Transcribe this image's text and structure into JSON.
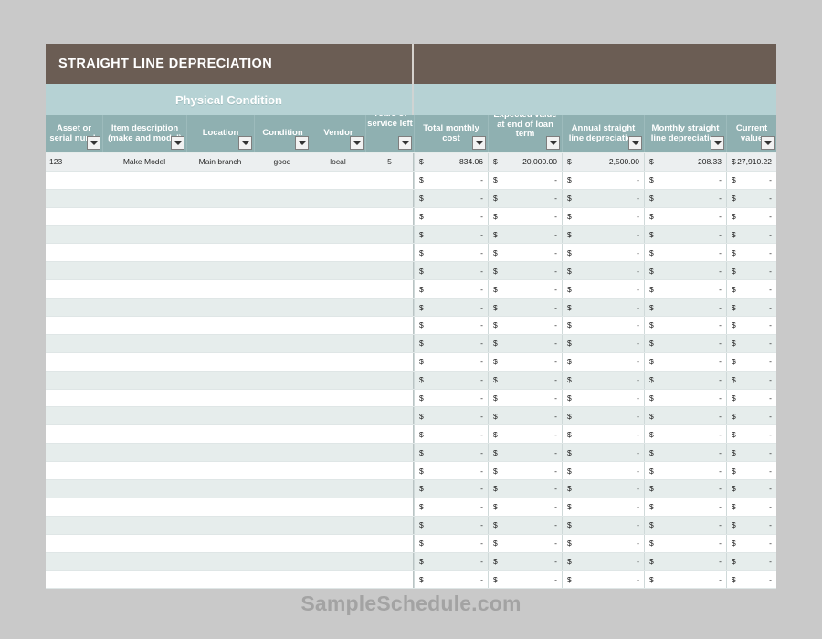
{
  "title": "STRAIGHT LINE DEPRECIATION",
  "group_band": {
    "label": "Physical Condition"
  },
  "colors": {
    "title_bar": "#6b5d54",
    "group_band": "#b6d2d4",
    "header_row": "#8fb0b1",
    "row_stripe": "#e6edec",
    "page_background": "#c9c9c9",
    "watermark": "#a3a3a3"
  },
  "columns": [
    {
      "key": "asset",
      "label": "Asset or serial number",
      "filter": true
    },
    {
      "key": "item",
      "label": "Item description (make and model)",
      "filter": true
    },
    {
      "key": "loc",
      "label": "Location",
      "filter": true
    },
    {
      "key": "cond",
      "label": "Condition",
      "filter": true
    },
    {
      "key": "vendor",
      "label": "Vendor",
      "filter": true
    },
    {
      "key": "years",
      "label": "Years of service left",
      "filter": true
    },
    {
      "key": "total",
      "label": "Total monthly cost",
      "filter": true
    },
    {
      "key": "exp",
      "label": "Expected value at end of loan term",
      "filter": true
    },
    {
      "key": "annual",
      "label": "Annual straight line depreciation",
      "filter": true
    },
    {
      "key": "month",
      "label": "Monthly straight line depreciation",
      "filter": true
    },
    {
      "key": "curr",
      "label": "Current value",
      "filter": true
    }
  ],
  "header_labels": {
    "asset": "Asset or serial numb",
    "item": "Item description (make and model)",
    "loc": "Location",
    "cond": "Condition",
    "vendor": "Vendor",
    "years": "Years of service left",
    "total": "Total monthly cost",
    "exp": "Expected value at end of loan term",
    "annual": "Annual straight line depreciation",
    "month": "Monthly straight line depreciation",
    "curr": "Current value"
  },
  "currency_symbol": "$",
  "empty_value": "-",
  "rows": [
    {
      "asset": "123",
      "item": "Make Model",
      "loc": "Main branch",
      "cond": "good",
      "vendor": "local",
      "years": "5",
      "total": "834.06",
      "exp": "20,000.00",
      "annual": "2,500.00",
      "month": "208.33",
      "curr": "27,910.22"
    },
    {
      "asset": "",
      "item": "",
      "loc": "",
      "cond": "",
      "vendor": "",
      "years": "",
      "total": "-",
      "exp": "-",
      "annual": "-",
      "month": "-",
      "curr": "-"
    },
    {
      "asset": "",
      "item": "",
      "loc": "",
      "cond": "",
      "vendor": "",
      "years": "",
      "total": "-",
      "exp": "-",
      "annual": "-",
      "month": "-",
      "curr": "-"
    },
    {
      "asset": "",
      "item": "",
      "loc": "",
      "cond": "",
      "vendor": "",
      "years": "",
      "total": "-",
      "exp": "-",
      "annual": "-",
      "month": "-",
      "curr": "-"
    },
    {
      "asset": "",
      "item": "",
      "loc": "",
      "cond": "",
      "vendor": "",
      "years": "",
      "total": "-",
      "exp": "-",
      "annual": "-",
      "month": "-",
      "curr": "-"
    },
    {
      "asset": "",
      "item": "",
      "loc": "",
      "cond": "",
      "vendor": "",
      "years": "",
      "total": "-",
      "exp": "-",
      "annual": "-",
      "month": "-",
      "curr": "-"
    },
    {
      "asset": "",
      "item": "",
      "loc": "",
      "cond": "",
      "vendor": "",
      "years": "",
      "total": "-",
      "exp": "-",
      "annual": "-",
      "month": "-",
      "curr": "-"
    },
    {
      "asset": "",
      "item": "",
      "loc": "",
      "cond": "",
      "vendor": "",
      "years": "",
      "total": "-",
      "exp": "-",
      "annual": "-",
      "month": "-",
      "curr": "-"
    },
    {
      "asset": "",
      "item": "",
      "loc": "",
      "cond": "",
      "vendor": "",
      "years": "",
      "total": "-",
      "exp": "-",
      "annual": "-",
      "month": "-",
      "curr": "-"
    },
    {
      "asset": "",
      "item": "",
      "loc": "",
      "cond": "",
      "vendor": "",
      "years": "",
      "total": "-",
      "exp": "-",
      "annual": "-",
      "month": "-",
      "curr": "-"
    },
    {
      "asset": "",
      "item": "",
      "loc": "",
      "cond": "",
      "vendor": "",
      "years": "",
      "total": "-",
      "exp": "-",
      "annual": "-",
      "month": "-",
      "curr": "-"
    },
    {
      "asset": "",
      "item": "",
      "loc": "",
      "cond": "",
      "vendor": "",
      "years": "",
      "total": "-",
      "exp": "-",
      "annual": "-",
      "month": "-",
      "curr": "-"
    },
    {
      "asset": "",
      "item": "",
      "loc": "",
      "cond": "",
      "vendor": "",
      "years": "",
      "total": "-",
      "exp": "-",
      "annual": "-",
      "month": "-",
      "curr": "-"
    },
    {
      "asset": "",
      "item": "",
      "loc": "",
      "cond": "",
      "vendor": "",
      "years": "",
      "total": "-",
      "exp": "-",
      "annual": "-",
      "month": "-",
      "curr": "-"
    },
    {
      "asset": "",
      "item": "",
      "loc": "",
      "cond": "",
      "vendor": "",
      "years": "",
      "total": "-",
      "exp": "-",
      "annual": "-",
      "month": "-",
      "curr": "-"
    },
    {
      "asset": "",
      "item": "",
      "loc": "",
      "cond": "",
      "vendor": "",
      "years": "",
      "total": "-",
      "exp": "-",
      "annual": "-",
      "month": "-",
      "curr": "-"
    },
    {
      "asset": "",
      "item": "",
      "loc": "",
      "cond": "",
      "vendor": "",
      "years": "",
      "total": "-",
      "exp": "-",
      "annual": "-",
      "month": "-",
      "curr": "-"
    },
    {
      "asset": "",
      "item": "",
      "loc": "",
      "cond": "",
      "vendor": "",
      "years": "",
      "total": "-",
      "exp": "-",
      "annual": "-",
      "month": "-",
      "curr": "-"
    },
    {
      "asset": "",
      "item": "",
      "loc": "",
      "cond": "",
      "vendor": "",
      "years": "",
      "total": "-",
      "exp": "-",
      "annual": "-",
      "month": "-",
      "curr": "-"
    },
    {
      "asset": "",
      "item": "",
      "loc": "",
      "cond": "",
      "vendor": "",
      "years": "",
      "total": "-",
      "exp": "-",
      "annual": "-",
      "month": "-",
      "curr": "-"
    },
    {
      "asset": "",
      "item": "",
      "loc": "",
      "cond": "",
      "vendor": "",
      "years": "",
      "total": "-",
      "exp": "-",
      "annual": "-",
      "month": "-",
      "curr": "-"
    },
    {
      "asset": "",
      "item": "",
      "loc": "",
      "cond": "",
      "vendor": "",
      "years": "",
      "total": "-",
      "exp": "-",
      "annual": "-",
      "month": "-",
      "curr": "-"
    },
    {
      "asset": "",
      "item": "",
      "loc": "",
      "cond": "",
      "vendor": "",
      "years": "",
      "total": "-",
      "exp": "-",
      "annual": "-",
      "month": "-",
      "curr": "-"
    },
    {
      "asset": "",
      "item": "",
      "loc": "",
      "cond": "",
      "vendor": "",
      "years": "",
      "total": "-",
      "exp": "-",
      "annual": "-",
      "month": "-",
      "curr": "-"
    }
  ],
  "watermark": "SampleSchedule.com"
}
